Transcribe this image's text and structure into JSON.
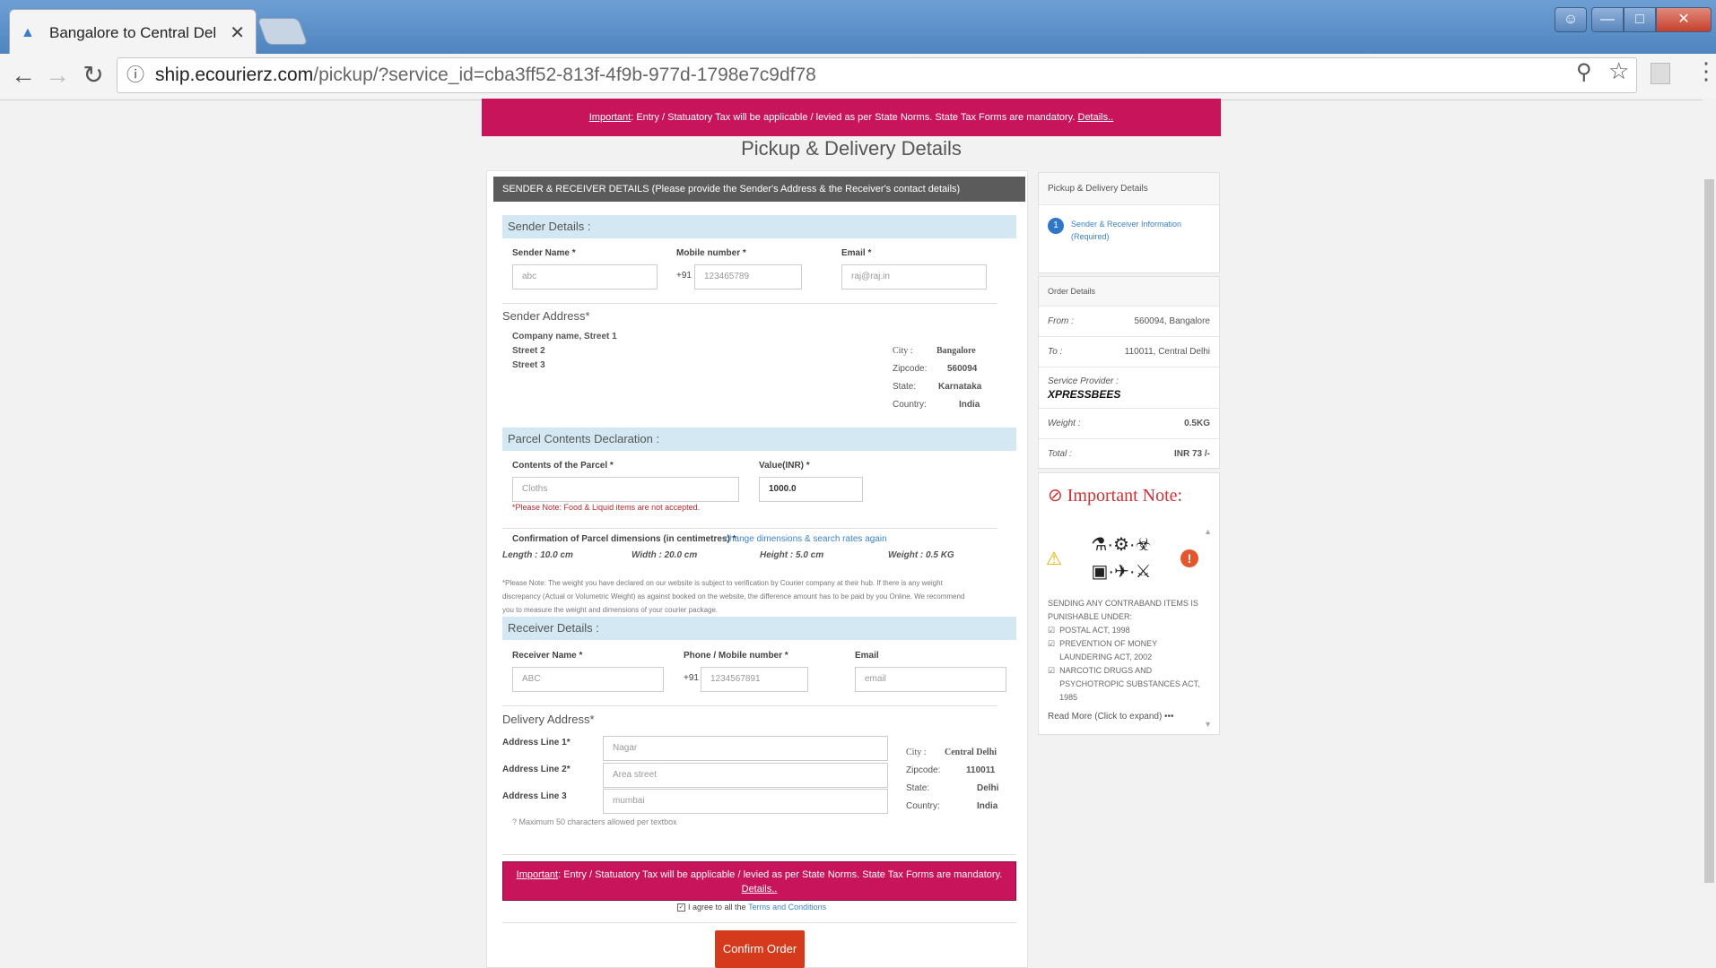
{
  "browser": {
    "tab_title": "Bangalore to Central Del",
    "url_host": "ship.ecourierz.com",
    "url_path": "/pickup/?service_id=cba3ff52-813f-4f9b-977d-1798e7c9df78"
  },
  "banner": {
    "important": "Important",
    "text": ": Entry / Statuatory Tax will be applicable / levied as per State Norms. State Tax Forms are mandatory.",
    "details": "Details.."
  },
  "page_title": "Pickup & Delivery Details",
  "section_header": "SENDER & RECEIVER DETAILS (Please provide the Sender's Address & the Receiver's contact details)",
  "sender": {
    "heading": "Sender Details :",
    "name_label": "Sender Name *",
    "name_value": "abc",
    "mobile_label": "Mobile number *",
    "prefix": "+91",
    "mobile_value": "123465789",
    "email_label": "Email *",
    "email_value": "raj@raj.in",
    "address_heading": "Sender Address*",
    "street1": "Company name, Street 1",
    "street2": "Street 2",
    "street3": "Street 3",
    "city_label": "City :",
    "city": "Bangalore",
    "zip_label": "Zipcode:",
    "zip": "560094",
    "state_label": "State:",
    "state": "Karnataka",
    "country_label": "Country:",
    "country": "India"
  },
  "parcel": {
    "heading": "Parcel Contents Declaration :",
    "contents_label": "Contents of the Parcel *",
    "contents_value": "Cloths",
    "value_label": "Value(INR) *",
    "value_value": "1000.0",
    "note": "*Please Note: Food & Liquid items are not accepted.",
    "confirm_label": "Confirmation of Parcel dimensions (in centimetres) *",
    "change_link": "change dimensions & search rates again",
    "length": "Length : 10.0 cm",
    "width": "Width : 20.0 cm",
    "height": "Height : 5.0 cm",
    "weight": "Weight : 0.5 KG",
    "disclaimer": "*Please Note: The weight you have declared on our website is subject to verification by Courier company at their hub. If there is any weight discrepancy (Actual or Volumetric Weight) as against booked on the website, the difference amount has to be paid by you Online. We recommend you to measure the weight and dimensions of your courier package."
  },
  "receiver": {
    "heading": "Receiver Details :",
    "name_label": "Receiver Name *",
    "name_value": "ABC",
    "phone_label": "Phone / Mobile number *",
    "prefix": "+91",
    "phone_value": "1234567891",
    "email_label": "Email",
    "email_placeholder": "email",
    "address_heading": "Delivery Address*",
    "line1_label": "Address Line 1*",
    "line1_value": "Nagar",
    "line2_label": "Address Line 2*",
    "line2_value": "Area street",
    "line3_label": "Address Line 3",
    "line3_value": "mumbai",
    "max_note": "? Maximum 50 characters allowed per textbox",
    "city_label": "City :",
    "city": "Central Delhi",
    "zip_label": "Zipcode:",
    "zip": "110011",
    "state_label": "State:",
    "state": "Delhi",
    "country_label": "Country:",
    "country": "India"
  },
  "agree": {
    "text": "I agree to all the",
    "link": "Terms and Conditions"
  },
  "confirm_button": "Confirm Order",
  "sidebar": {
    "steps_title": "Pickup & Delivery Details",
    "step_number": "1",
    "step_text": "Sender & Receiver Information (Required)",
    "order_title": "Order Details",
    "from_label": "From :",
    "from_value": "560094, Bangalore",
    "to_label": "To :",
    "to_value": "110011, Central Delhi",
    "provider_label": "Service Provider :",
    "provider_logo": "XPRESSBEES",
    "weight_label": "Weight :",
    "weight_value": "0.5KG",
    "total_label": "Total :",
    "total_value": "INR 73 /-",
    "note_title": "Important Note:",
    "note_intro": "SENDING ANY CONTRABAND ITEMS IS PUNISHABLE UNDER:",
    "acts": [
      "POSTAL ACT, 1998",
      "PREVENTION OF MONEY LAUNDERING ACT, 2002",
      "NARCOTIC DRUGS AND PSYCHOTROPIC SUBSTANCES ACT, 1985"
    ],
    "read_more": "Read More (Click to expand) •••"
  }
}
